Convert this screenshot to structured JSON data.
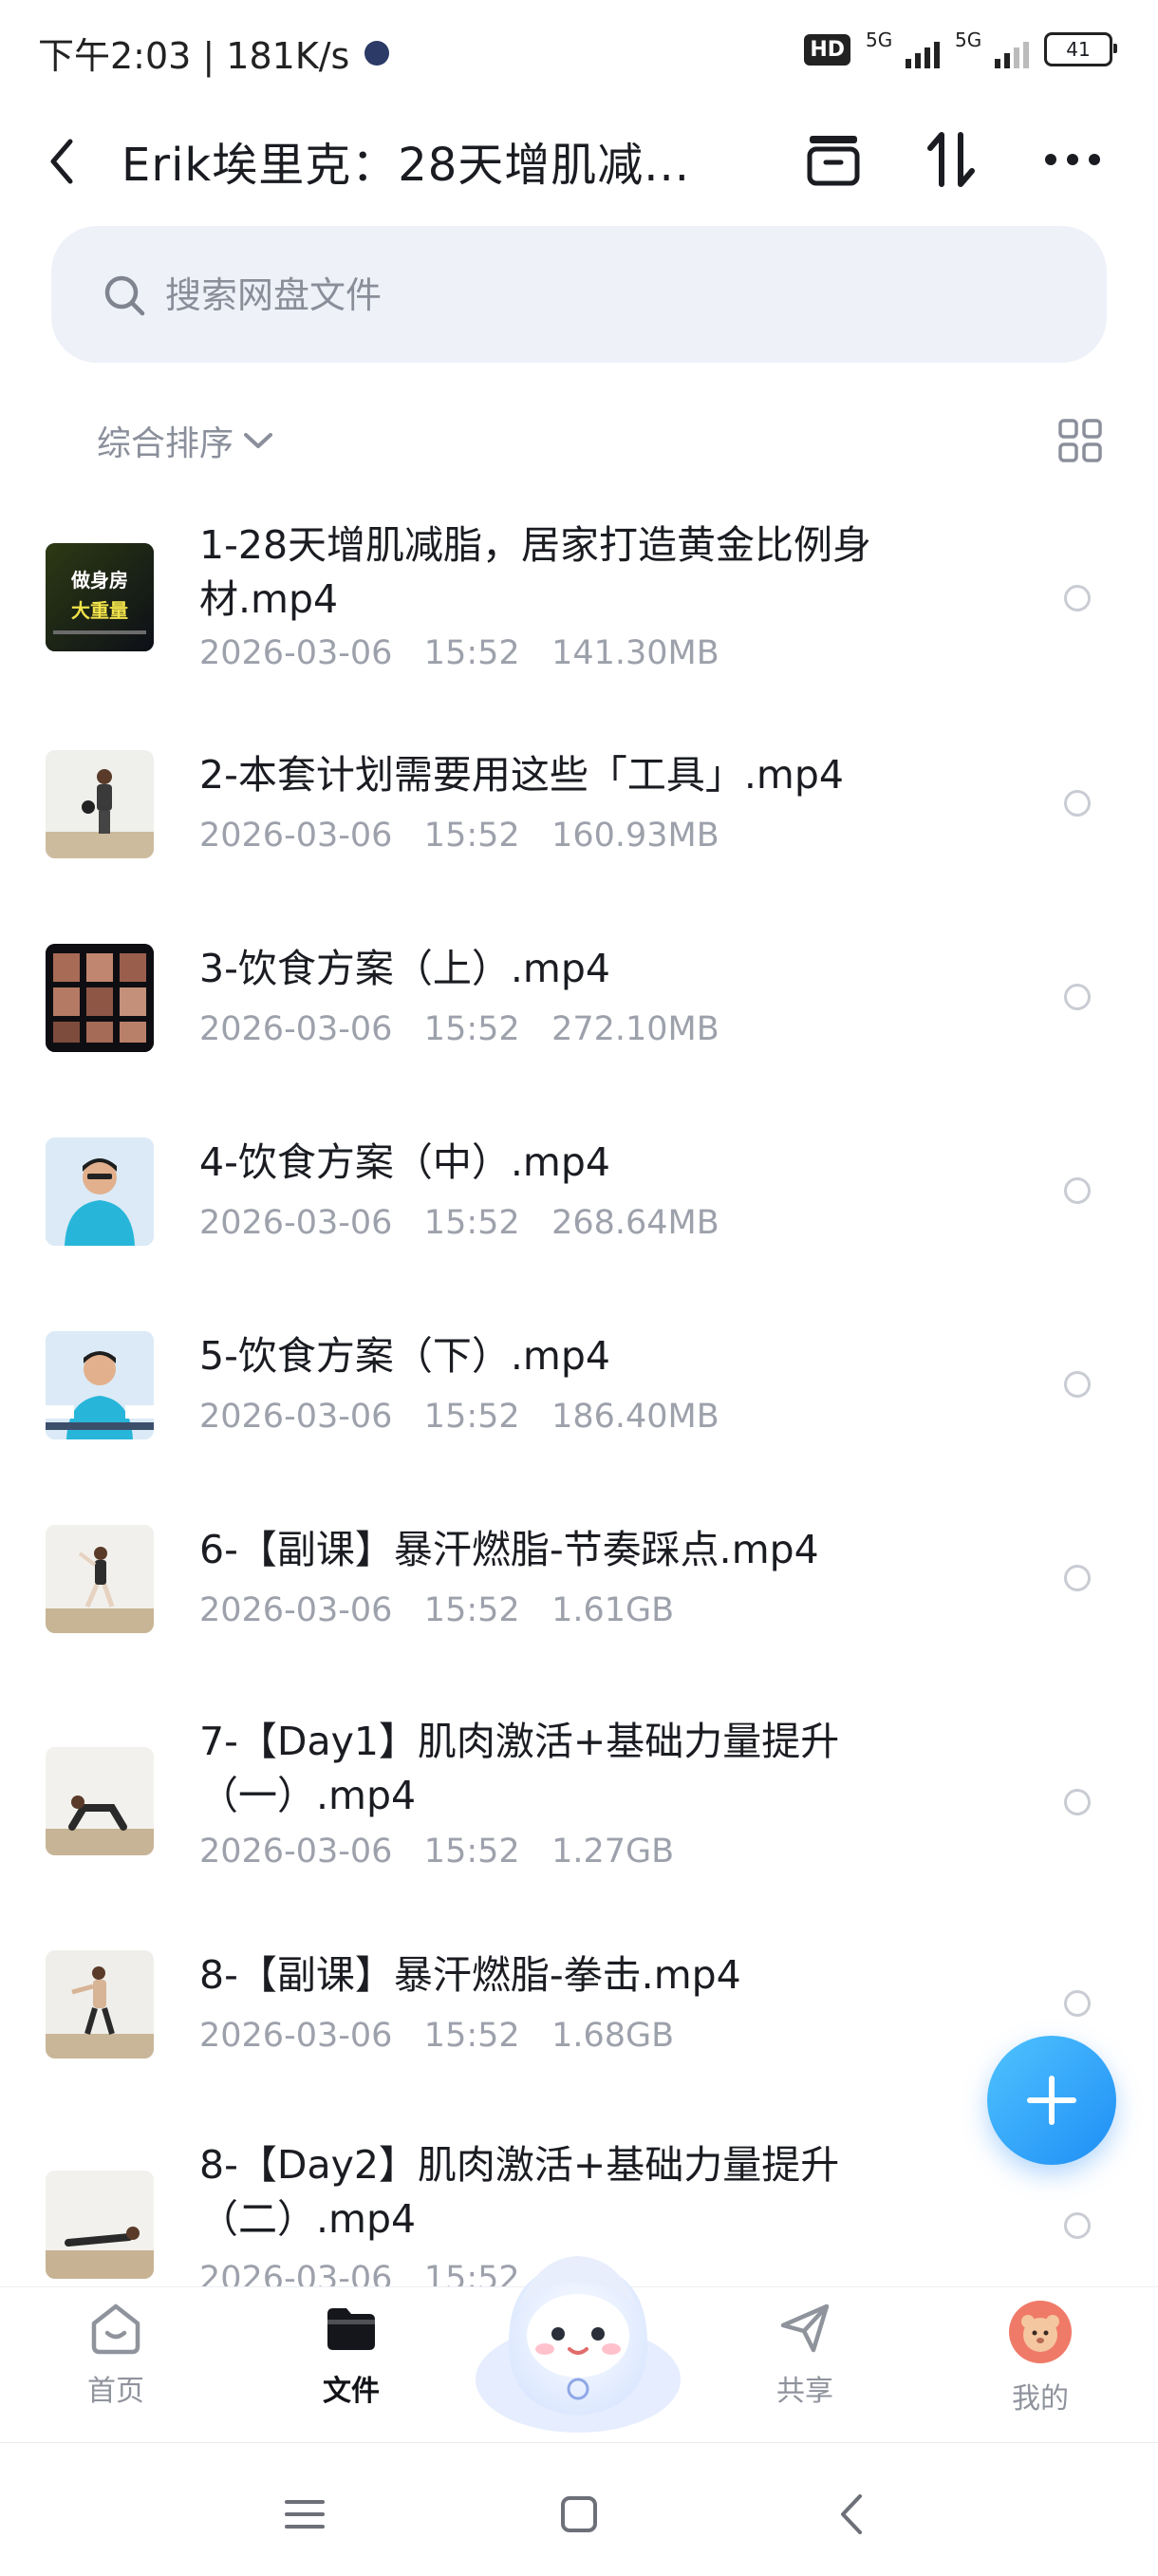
{
  "status_bar": {
    "time_speed": "下午2:03 | 181K/s",
    "hd_badge": "HD",
    "network_1": "5G",
    "network_2": "5G",
    "battery": "41"
  },
  "header": {
    "title": "Erik埃里克：28天增肌减...",
    "icons": [
      "archive-icon",
      "sort-icon",
      "more-icon"
    ]
  },
  "search": {
    "placeholder": "搜索网盘文件"
  },
  "sort": {
    "label": "综合排序"
  },
  "files": [
    {
      "name": "1-28天增肌减脂，居家打造黄金比例身材.mp4",
      "date": "2026-03-06",
      "time": "15:52",
      "size": "141.30MB",
      "thumb_text_1": "做身房",
      "thumb_text_2": "大重量"
    },
    {
      "name": "2-本套计划需要用这些「工具」.mp4",
      "date": "2026-03-06",
      "time": "15:52",
      "size": "160.93MB"
    },
    {
      "name": "3-饮食方案（上）.mp4",
      "date": "2026-03-06",
      "time": "15:52",
      "size": "272.10MB"
    },
    {
      "name": "4-饮食方案（中）.mp4",
      "date": "2026-03-06",
      "time": "15:52",
      "size": "268.64MB"
    },
    {
      "name": "5-饮食方案（下）.mp4",
      "date": "2026-03-06",
      "time": "15:52",
      "size": "186.40MB"
    },
    {
      "name": "6-【副课】暴汗燃脂-节奏踩点.mp4",
      "date": "2026-03-06",
      "time": "15:52",
      "size": "1.61GB"
    },
    {
      "name": "7-【Day1】肌肉激活+基础力量提升（一）.mp4",
      "date": "2026-03-06",
      "time": "15:52",
      "size": "1.27GB"
    },
    {
      "name": "8-【副课】暴汗燃脂-拳击.mp4",
      "date": "2026-03-06",
      "time": "15:52",
      "size": "1.68GB"
    },
    {
      "name": "8-【Day2】肌肉激活+基础力量提升（二）.mp4",
      "date": "2026-03-06",
      "time": "15:52",
      "size": ""
    }
  ],
  "bottom_nav": [
    {
      "label": "首页",
      "icon": "home-icon"
    },
    {
      "label": "文件",
      "icon": "folder-icon",
      "active": true
    },
    {
      "label": "",
      "icon": "assistant-mascot"
    },
    {
      "label": "共享",
      "icon": "share-icon"
    },
    {
      "label": "我的",
      "icon": "avatar"
    }
  ],
  "colors": {
    "accent": "#2b8ff7",
    "text": "#1a1c22",
    "muted": "#9da1ab",
    "search_bg": "#eef1f8"
  }
}
